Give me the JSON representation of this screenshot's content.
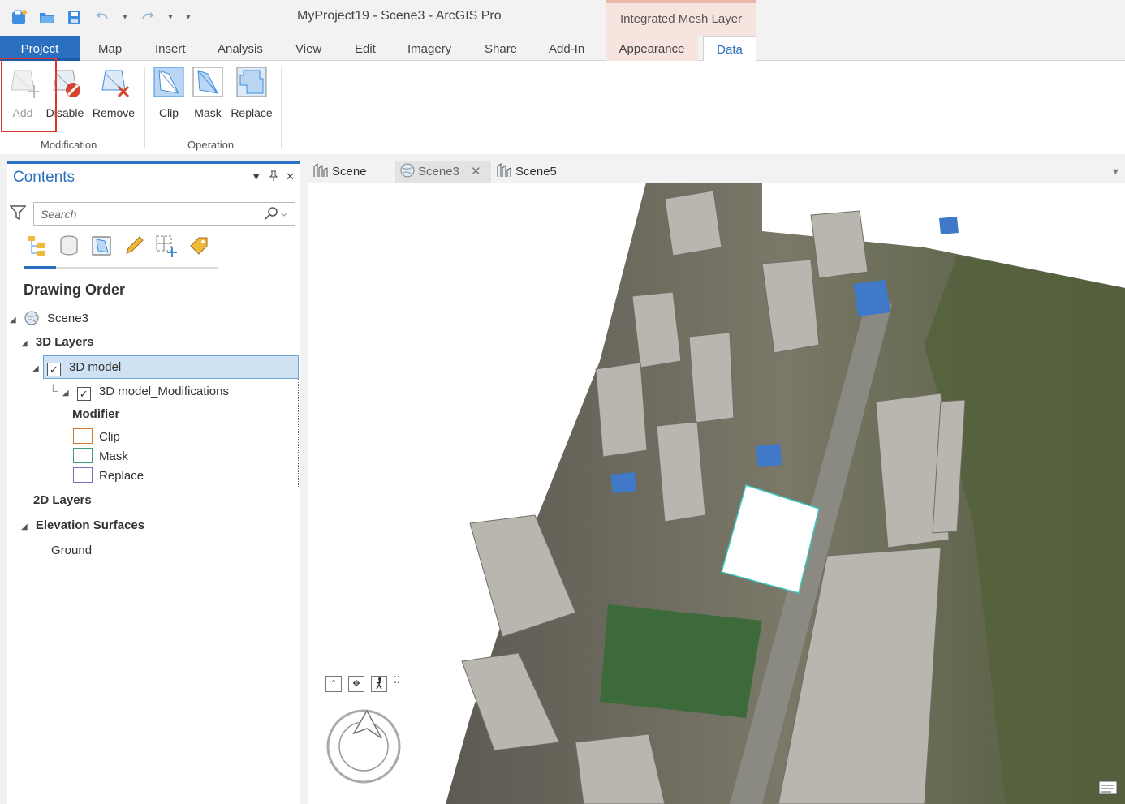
{
  "window": {
    "title": "MyProject19 - Scene3 - ArcGIS Pro",
    "contextual_group": "Integrated Mesh Layer"
  },
  "ribbon_tabs": [
    "Project",
    "Map",
    "Insert",
    "Analysis",
    "View",
    "Edit",
    "Imagery",
    "Share",
    "Add-In",
    "Appearance",
    "Data"
  ],
  "ribbon": {
    "groups": [
      {
        "label": "Modification",
        "buttons": [
          "Add",
          "Disable",
          "Remove"
        ]
      },
      {
        "label": "Operation",
        "buttons": [
          "Clip",
          "Mask",
          "Replace"
        ]
      }
    ]
  },
  "contents": {
    "title": "Contents",
    "search_placeholder": "Search",
    "section_title": "Drawing Order",
    "scene_name": "Scene3",
    "groups": {
      "layers3d": "3D Layers",
      "layers2d": "2D Layers",
      "elevation": "Elevation Surfaces",
      "ground": "Ground"
    },
    "layer": "3D model",
    "sublayer": "3D model_Modifications",
    "modifier_heading": "Modifier",
    "modifiers": [
      {
        "label": "Clip",
        "color": "#d0782c"
      },
      {
        "label": "Mask",
        "color": "#3a9e86"
      },
      {
        "label": "Replace",
        "color": "#7b6bc0"
      }
    ]
  },
  "map_tabs": [
    "Scene",
    "Scene3",
    "Scene5"
  ],
  "colors": {
    "accent": "#2b6fc0",
    "context_tab": "#f6e4de",
    "highlight": "#e03333"
  }
}
